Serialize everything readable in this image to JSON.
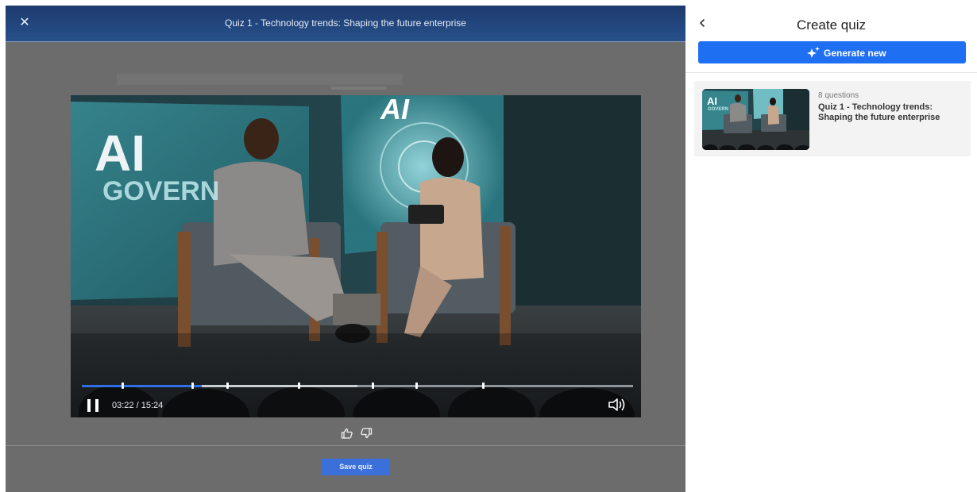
{
  "modal": {
    "title": "Quiz 1 - Technology trends: Shaping the future enterprise",
    "close_icon": "close-icon"
  },
  "video": {
    "current_time": "03:22",
    "separator": " / ",
    "duration": "15:24",
    "progress_fraction": 0.218,
    "buffered_fraction": 0.5,
    "marker_fractions": [
      0.074,
      0.2,
      0.263,
      0.394,
      0.527,
      0.606,
      0.727
    ],
    "backdrop_text_line1": "AI",
    "backdrop_text_line2": "GOVERN",
    "screen_badge": "AI",
    "icons": [
      "pause-icon",
      "volume-icon"
    ]
  },
  "reactions": {
    "like_icon": "thumbs-up-icon",
    "dislike_icon": "thumbs-down-icon"
  },
  "footer": {
    "save_label": "Save quiz"
  },
  "panel": {
    "back_icon": "chevron-left-icon",
    "title": "Create quiz",
    "generate_label": "Generate new",
    "generate_icon": "sparkle-icon",
    "colors": {
      "accent": "#1f6ff2",
      "header": "#1d3a6e"
    }
  },
  "quiz_list": [
    {
      "count": "8 questions",
      "title": "Quiz 1 - Technology trends: Shaping the future enterprise",
      "thumb_text_line1": "AI",
      "thumb_text_line2": "GOVERN"
    }
  ]
}
